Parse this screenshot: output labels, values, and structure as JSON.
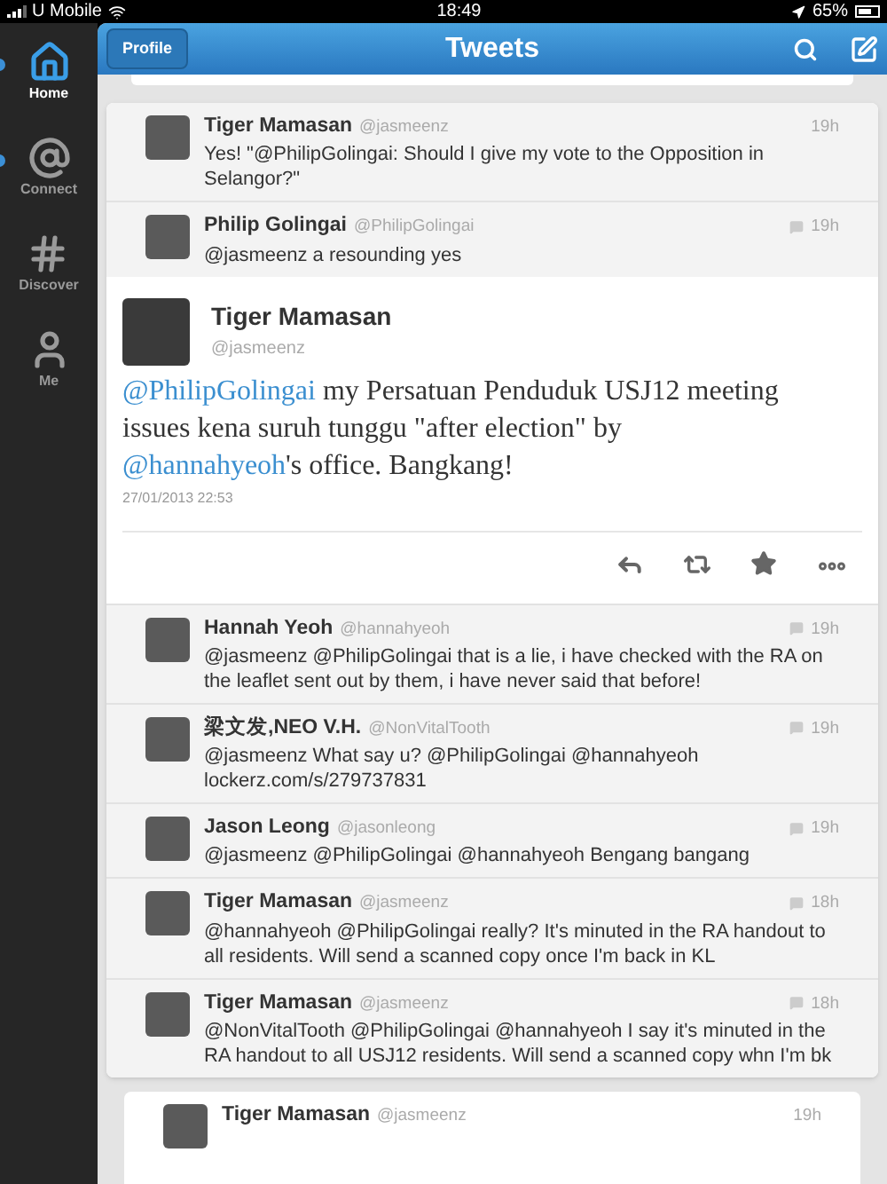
{
  "status_bar": {
    "carrier": "U Mobile",
    "time": "18:49",
    "battery": "65%"
  },
  "sidebar": {
    "items": [
      {
        "label": "Home",
        "selected": true,
        "unread": true
      },
      {
        "label": "Connect",
        "selected": false,
        "unread": true
      },
      {
        "label": "Discover",
        "selected": false,
        "unread": false
      },
      {
        "label": "Me",
        "selected": false,
        "unread": false
      }
    ]
  },
  "nav_bar": {
    "back_button": "Profile",
    "title": "Tweets"
  },
  "conversation_above": [
    {
      "name": "Tiger Mamasan",
      "handle": "@jasmeenz",
      "time": "19h",
      "replied": false,
      "text": "Yes! \"@PhilipGolingai: Should I give my vote to the Opposition in Selangor?\""
    },
    {
      "name": "Philip Golingai",
      "handle": "@PhilipGolingai",
      "time": "19h",
      "replied": true,
      "text": "@jasmeenz a resounding yes"
    }
  ],
  "main_tweet": {
    "name": "Tiger Mamasan",
    "handle": "@jasmeenz",
    "segments": [
      {
        "kind": "mention",
        "text": "@PhilipGolingai"
      },
      {
        "kind": "text",
        "text": " my Persatuan Penduduk USJ12 meeting issues kena suruh tunggu \"after election\" by "
      },
      {
        "kind": "mention",
        "text": "@hannahyeoh"
      },
      {
        "kind": "text",
        "text": "'s office. Bangkang!"
      }
    ],
    "timestamp": "27/01/2013 22:53"
  },
  "replies": [
    {
      "name": "Hannah Yeoh",
      "handle": "@hannahyeoh",
      "time": "19h",
      "replied": true,
      "text": "@jasmeenz @PhilipGolingai that is a lie, i have checked with the RA on the leaflet sent out by them, i have never said that before!"
    },
    {
      "name": "梁文发,NEO V.H.",
      "handle": "@NonVitalTooth",
      "time": "19h",
      "replied": true,
      "text": "@jasmeenz What say u? @PhilipGolingai @hannahyeoh lockerz.com/s/279737831"
    },
    {
      "name": "Jason Leong",
      "handle": "@jasonleong",
      "time": "19h",
      "replied": true,
      "text": "@jasmeenz @PhilipGolingai @hannahyeoh Bengang bangang"
    },
    {
      "name": "Tiger Mamasan",
      "handle": "@jasmeenz",
      "time": "18h",
      "replied": true,
      "text": "@hannahyeoh @PhilipGolingai really? It's minuted in the RA handout to all residents. Will send a scanned copy once I'm back in KL"
    },
    {
      "name": "Tiger Mamasan",
      "handle": "@jasmeenz",
      "time": "18h",
      "replied": true,
      "text": "@NonVitalTooth @PhilipGolingai @hannahyeoh I say it's minuted in the RA handout to all USJ12 residents. Will send a scanned copy whn I'm bk"
    }
  ],
  "next_tweet": {
    "name": "Tiger Mamasan",
    "handle": "@jasmeenz",
    "time": "19h"
  }
}
